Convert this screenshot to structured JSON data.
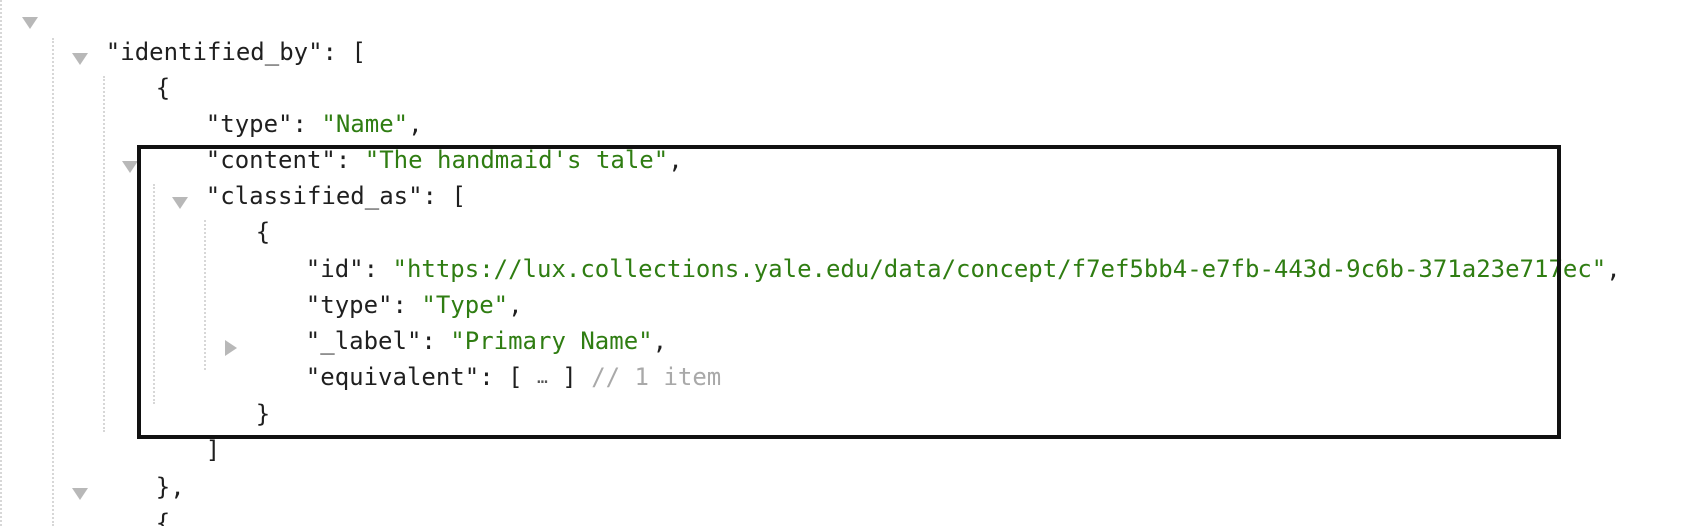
{
  "json_view": {
    "lines": {
      "identified_by_key": "\"identified_by\"",
      "identified_by_open": ": [",
      "obj_open": "{",
      "type_key": "\"type\"",
      "type_sep": ": ",
      "type_value": "\"Name\"",
      "type_comma": ",",
      "content_key": "\"content\"",
      "content_sep": ": ",
      "content_value": "\"The handmaid's tale\"",
      "content_comma": ",",
      "classified_as_key": "\"classified_as\"",
      "classified_as_open": ": [",
      "inner_obj_open": "{",
      "id_key": "\"id\"",
      "id_sep": ": ",
      "id_value": "\"https://lux.collections.yale.edu/data/concept/f7ef5bb4-e7fb-443d-9c6b-371a23e717ec\"",
      "id_comma": ",",
      "inner_type_key": "\"type\"",
      "inner_type_sep": ": ",
      "inner_type_value": "\"Type\"",
      "inner_type_comma": ",",
      "label_key": "\"_label\"",
      "label_sep": ": ",
      "label_value": "\"Primary Name\"",
      "label_comma": ",",
      "equivalent_key": "\"equivalent\"",
      "equivalent_sep": ": ",
      "equivalent_open": "[",
      "equivalent_ellipsis": "…",
      "equivalent_close": "]",
      "equivalent_comment": "// 1 item",
      "inner_obj_close": "}",
      "classified_as_close": "]",
      "obj_close": "},",
      "next_obj_open": "{"
    }
  }
}
